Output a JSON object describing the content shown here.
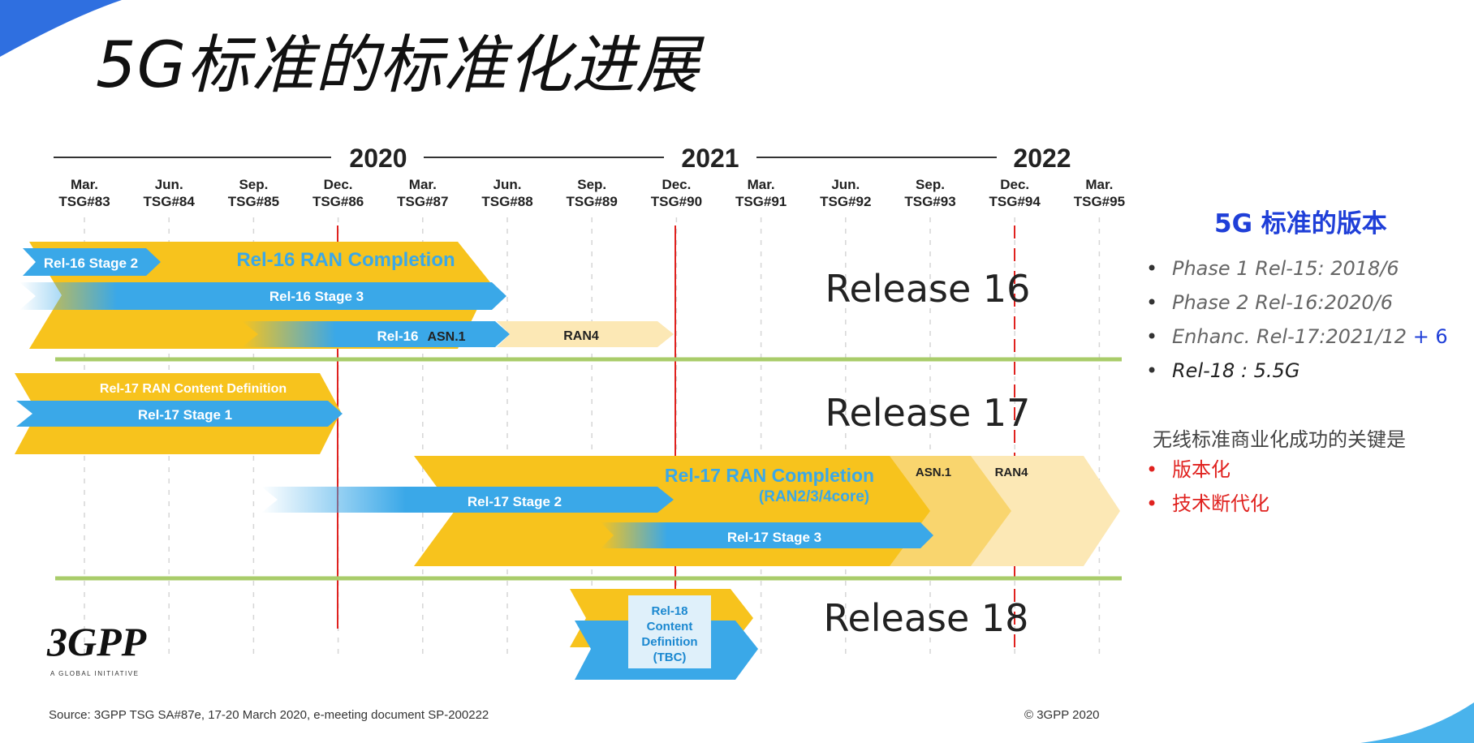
{
  "title": "5G标准的标准化进展",
  "timeline": {
    "years": [
      "2020",
      "2021",
      "2022"
    ],
    "ticks": [
      {
        "month": "Mar.",
        "tsg": "TSG#83"
      },
      {
        "month": "Jun.",
        "tsg": "TSG#84"
      },
      {
        "month": "Sep.",
        "tsg": "TSG#85"
      },
      {
        "month": "Dec.",
        "tsg": "TSG#86"
      },
      {
        "month": "Mar.",
        "tsg": "TSG#87"
      },
      {
        "month": "Jun.",
        "tsg": "TSG#88"
      },
      {
        "month": "Sep.",
        "tsg": "TSG#89"
      },
      {
        "month": "Dec.",
        "tsg": "TSG#90"
      },
      {
        "month": "Mar.",
        "tsg": "TSG#91"
      },
      {
        "month": "Jun.",
        "tsg": "TSG#92"
      },
      {
        "month": "Sep.",
        "tsg": "TSG#93"
      },
      {
        "month": "Dec.",
        "tsg": "TSG#94"
      },
      {
        "month": "Mar.",
        "tsg": "TSG#95"
      }
    ]
  },
  "bars": {
    "rel16_stage2": "Rel-16 Stage 2",
    "rel16_ran_completion": "Rel-16 RAN Completion",
    "rel16_stage3": "Rel-16 Stage 3",
    "rel16_asn1_prefix": "Rel-16",
    "rel16_asn1": "ASN.1",
    "rel16_ran4": "RAN4",
    "rel17_content_def": "Rel-17 RAN Content Definition",
    "rel17_stage1": "Rel-17 Stage 1",
    "rel17_ran_completion": "Rel-17 RAN Completion",
    "rel17_ran_groups": "(RAN2/3/4core)",
    "rel17_asn1": "ASN.1",
    "rel17_ran4": "RAN4",
    "rel17_stage2": "Rel-17 Stage 2",
    "rel17_stage3": "Rel-17 Stage 3",
    "rel18_box": [
      "Rel-18",
      "Content",
      "Definition",
      "(TBC)"
    ]
  },
  "releases": [
    "Release 16",
    "Release 17",
    "Release 18"
  ],
  "logo": {
    "name": "3GPP",
    "tagline": "A GLOBAL INITIATIVE"
  },
  "source": "Source: 3GPP TSG SA#87e, 17-20 March 2020, e-meeting document SP-200222",
  "copyright": "© 3GPP 2020",
  "sidebar": {
    "title": "5G 标准的版本",
    "versions": [
      {
        "text": "Phase 1 Rel-15: 2018/6"
      },
      {
        "text": "Phase 2 Rel-16:2020/6"
      },
      {
        "text": "Enhanc. Rel-17:2021/12",
        "plus": " + 6"
      },
      {
        "text": "Rel-18 : 5.5G"
      }
    ],
    "key_heading": "无线标准商业化成功的关键是",
    "keys": [
      "版本化",
      "技术断代化"
    ]
  },
  "colors": {
    "gold": "#f7c31d",
    "blue": "#3aa8e8",
    "light_gold": "#fce8b5",
    "mid_gold": "#f9d56e",
    "divider_green": "#a9cc6a",
    "red_line": "#e0221f",
    "accent_blue": "#1f3fd8"
  }
}
